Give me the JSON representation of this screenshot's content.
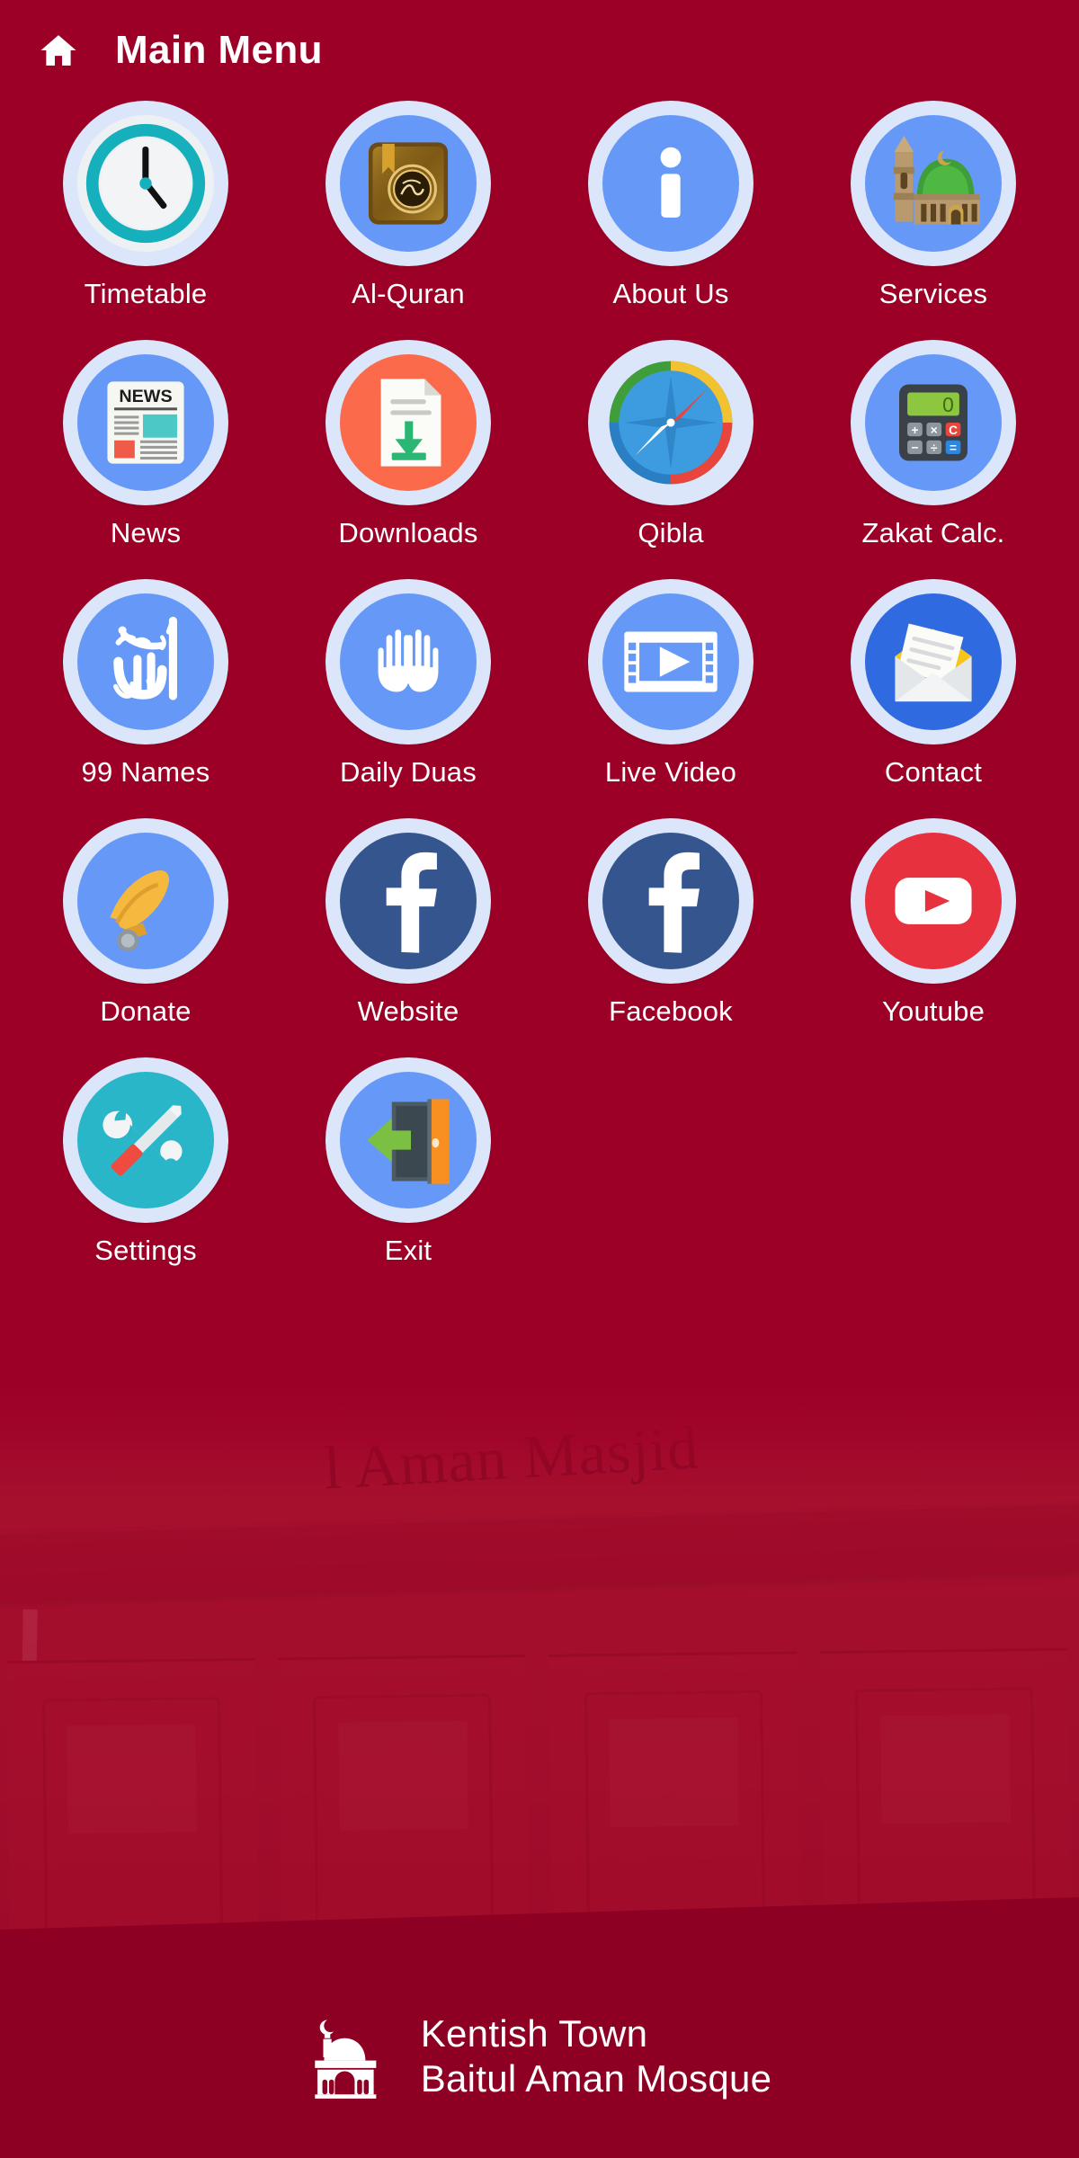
{
  "theme": {
    "background_red": "#9d0027",
    "footer_red": "#8d0023",
    "badge_ring": "#dce6fa",
    "icon_blue": "#6699f7",
    "icon_teal": "#29b6c8",
    "icon_orange": "#fa6a4b",
    "facebook_blue": "#35558f",
    "youtube_red": "#e8313f",
    "label_color": "#ffffff"
  },
  "header": {
    "home_icon": "home-icon",
    "title": "Main Menu"
  },
  "menu": {
    "items": [
      {
        "label": "Timetable",
        "icon": "clock-icon"
      },
      {
        "label": "Al-Quran",
        "icon": "quran-book-icon"
      },
      {
        "label": "About Us",
        "icon": "info-icon"
      },
      {
        "label": "Services",
        "icon": "mosque-icon"
      },
      {
        "label": "News",
        "icon": "newspaper-icon"
      },
      {
        "label": "Downloads",
        "icon": "download-document-icon"
      },
      {
        "label": "Qibla",
        "icon": "compass-icon"
      },
      {
        "label": "Zakat Calc.",
        "icon": "calculator-icon"
      },
      {
        "label": "99 Names",
        "icon": "allah-calligraphy-icon"
      },
      {
        "label": "Daily Duas",
        "icon": "praying-hands-icon"
      },
      {
        "label": "Live Video",
        "icon": "film-play-icon"
      },
      {
        "label": "Contact",
        "icon": "envelope-letter-icon"
      },
      {
        "label": "Donate",
        "icon": "hand-coin-icon"
      },
      {
        "label": "Website",
        "icon": "facebook-icon"
      },
      {
        "label": "Facebook",
        "icon": "facebook-icon"
      },
      {
        "label": "Youtube",
        "icon": "youtube-icon"
      },
      {
        "label": "Settings",
        "icon": "tools-icon"
      },
      {
        "label": "Exit",
        "icon": "exit-door-icon"
      }
    ]
  },
  "calculator": {
    "display_value": "0",
    "keys": [
      "+",
      "×",
      "C",
      "−",
      "÷",
      "="
    ]
  },
  "news_icon": {
    "masthead": "NEWS"
  },
  "background": {
    "signage_text": "l Aman Masjid"
  },
  "footer": {
    "logo_icon": "mosque-logo-icon",
    "line1": "Kentish Town",
    "line2": "Baitul Aman Mosque"
  }
}
